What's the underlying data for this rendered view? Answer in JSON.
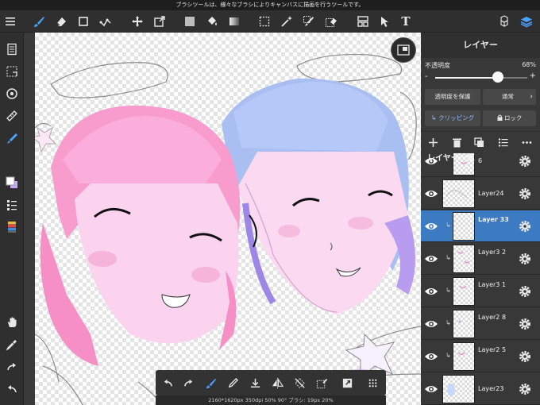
{
  "hint_bar": {
    "text": "ブラシツールは、様々なブラシによりキャンバスに描画を行うツールです。"
  },
  "toolbar": {
    "text_tool": "T"
  },
  "layer_panel": {
    "title": "レイヤー",
    "opacity_label": "不透明度",
    "opacity_value": "68%",
    "opacity_fraction": 0.68,
    "minus": "-",
    "plus": "+",
    "protect_alpha": "透明度を保護",
    "blend_mode": "通常",
    "clipping": "クリッピング",
    "lock": "ロック",
    "list_title": "レイヤー一覧",
    "layers": [
      {
        "name": "6",
        "thumb": "partial"
      },
      {
        "name": "Layer24",
        "thumb": "wide"
      },
      {
        "name": "Layer 33",
        "thumb": "clip",
        "selected": true
      },
      {
        "name": "Layer3 2",
        "thumb": "clip"
      },
      {
        "name": "Layer3 1",
        "thumb": "clip"
      },
      {
        "name": "Layer2 8",
        "thumb": "clip"
      },
      {
        "name": "Layer2 5",
        "thumb": "clip"
      },
      {
        "name": "Layer23",
        "thumb": "wide"
      }
    ]
  },
  "status_strip": {
    "text": "2160*1620px 350dpi 50% 90° ブラシ: 19px 20%"
  },
  "colors": {
    "accent": "#3c7ac1",
    "panel": "#383838",
    "toolbar": "#2f2f2f"
  }
}
